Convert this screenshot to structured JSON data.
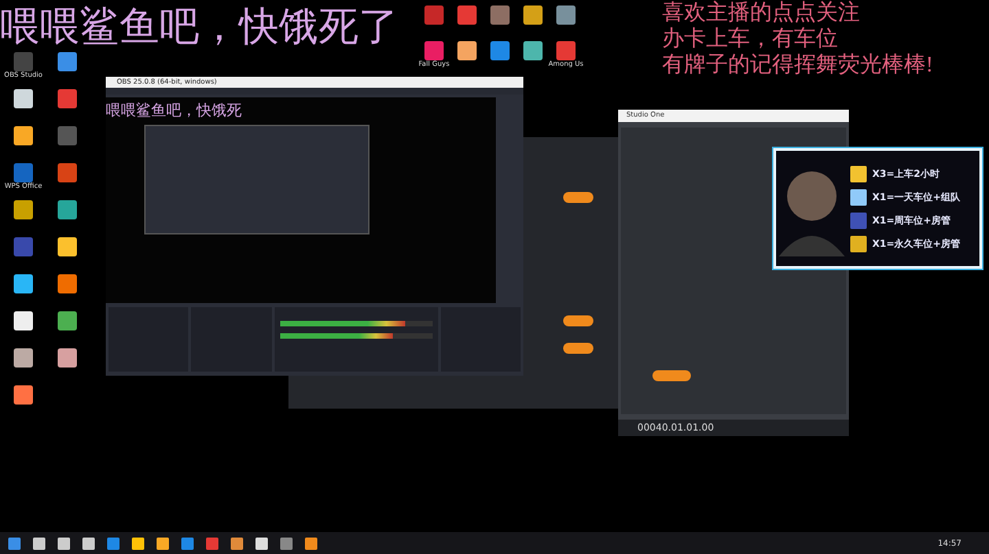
{
  "overlay_left": {
    "text": "喂喂鲨鱼吧，快饿死了"
  },
  "overlay_right": {
    "lines": [
      "喜欢主播的点点关注",
      "办卡上车，有车位",
      "有牌子的记得挥舞荧光棒棒!"
    ]
  },
  "desktop_icons_left": [
    {
      "label": "OBS Studio",
      "color": "#444444"
    },
    {
      "color": "#3a8ee6"
    },
    {
      "color": "#cfd8dc"
    },
    {
      "color": "#e53935"
    },
    {
      "color": "#f9a825"
    },
    {
      "color": "#555555"
    },
    {
      "label": "WPS Office",
      "color": "#1565c0"
    },
    {
      "color": "#d84315"
    },
    {
      "color": "#c8a000"
    },
    {
      "color": "#26a69a"
    },
    {
      "color": "#3949ab"
    },
    {
      "color": "#fbc02d"
    },
    {
      "color": "#29b6f6"
    },
    {
      "color": "#ef6c00"
    },
    {
      "color": "#eeeeee"
    },
    {
      "color": "#4caf50"
    },
    {
      "color": "#bcaaa4"
    },
    {
      "color": "#d7a0a0"
    },
    {
      "color": "#ff7043"
    }
  ],
  "desktop_icons_top": [
    {
      "color": "#c62828"
    },
    {
      "color": "#e53935"
    },
    {
      "color": "#8d6e63"
    },
    {
      "color": "#d4a017"
    },
    {
      "color": "#78909c"
    },
    {
      "label": "Fall Guys",
      "color": "#e91e63"
    },
    {
      "color": "#f4a460"
    },
    {
      "color": "#1e88e5"
    },
    {
      "color": "#4db6ac"
    },
    {
      "label": "Among Us",
      "color": "#e53935"
    }
  ],
  "obs": {
    "title": "OBS 25.0.8 (64-bit, windows)",
    "preview_caption": "喂喂鲨鱼吧，快饿死",
    "meters": [
      {
        "level": 0.82
      },
      {
        "level": 0.74
      }
    ]
  },
  "donation_card": {
    "rewards": [
      {
        "text": "X3=上车2小时",
        "color": "#f2c230"
      },
      {
        "text": "X1=一天车位+组队",
        "color": "#90caf9"
      },
      {
        "text": "X1=周车位+房管",
        "color": "#3f51b5"
      },
      {
        "text": "X1=永久车位+房管",
        "color": "#e0b020"
      }
    ]
  },
  "studio_one": {
    "title": "Studio One",
    "timecode": "00040.01.01.00"
  },
  "taskbar": {
    "time": "14:57"
  }
}
